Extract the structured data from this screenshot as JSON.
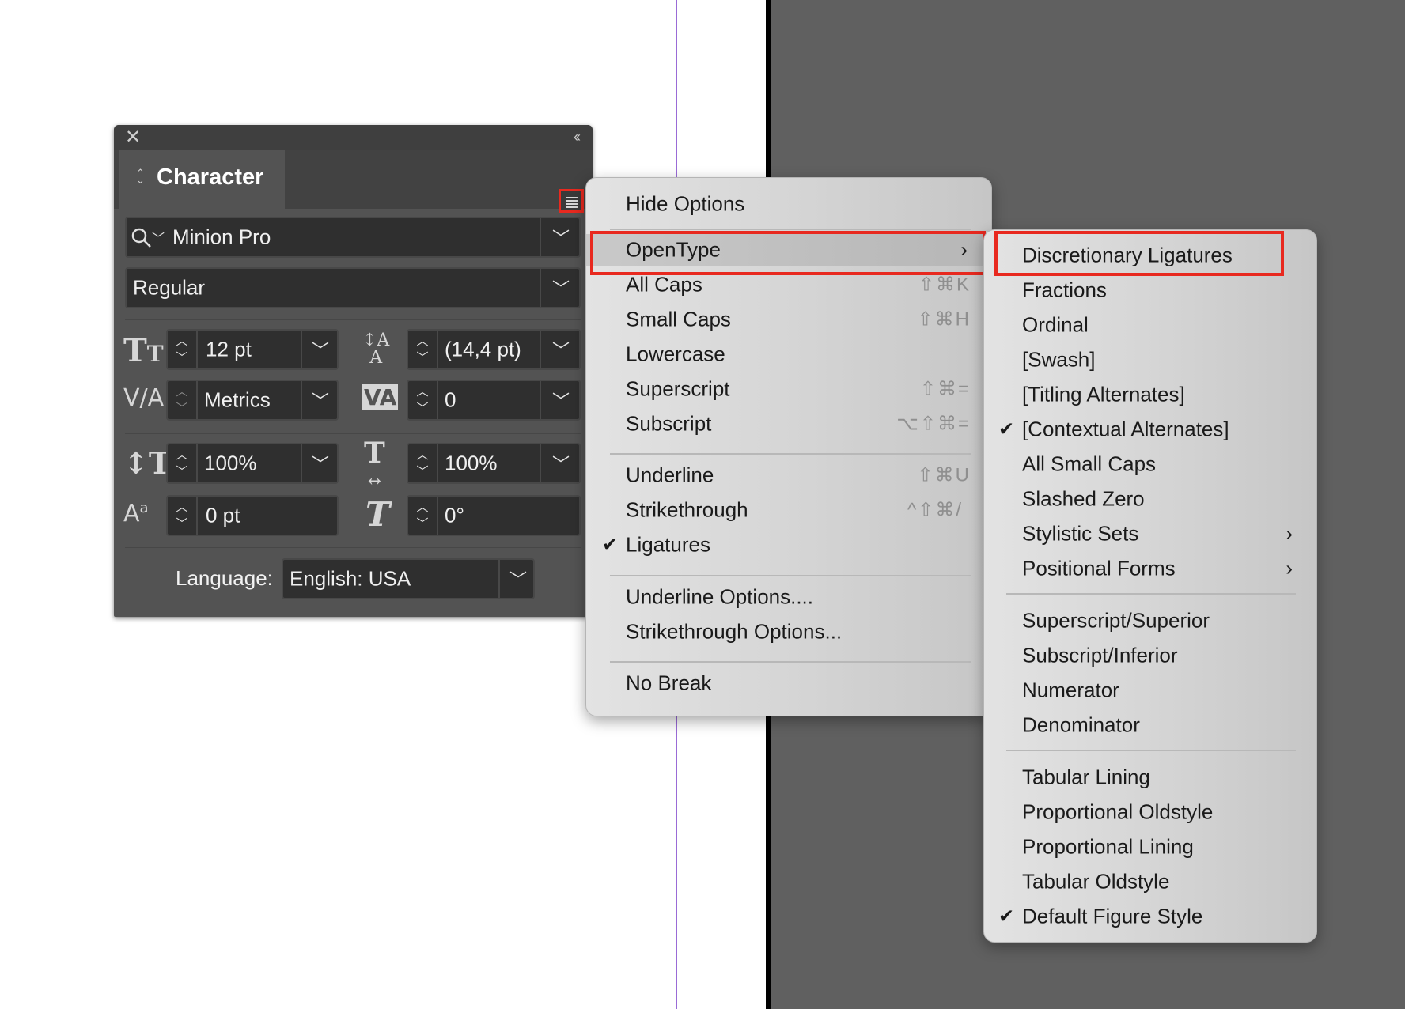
{
  "panel": {
    "title": "Character",
    "font_family": "Minion Pro",
    "font_style": "Regular",
    "font_size": "12 pt",
    "leading": "(14,4 pt)",
    "kerning": "Metrics",
    "tracking": "0",
    "vertical_scale": "100%",
    "horizontal_scale": "100%",
    "baseline_shift": "0 pt",
    "skew": "0°",
    "language_label": "Language:",
    "language_value": "English: USA"
  },
  "menu": {
    "items": [
      {
        "label": "Hide Options"
      },
      {
        "label": "OpenType"
      },
      {
        "label": "All Caps",
        "shortcut": "⇧⌘K"
      },
      {
        "label": "Small Caps",
        "shortcut": "⇧⌘H"
      },
      {
        "label": "Lowercase"
      },
      {
        "label": "Superscript",
        "shortcut": "⇧⌘="
      },
      {
        "label": "Subscript",
        "shortcut": "⌥⇧⌘="
      },
      {
        "label": "Underline",
        "shortcut": "⇧⌘U"
      },
      {
        "label": "Strikethrough",
        "shortcut": "^⇧⌘/"
      },
      {
        "label": "Ligatures",
        "checked": true
      },
      {
        "label": "Underline Options...."
      },
      {
        "label": "Strikethrough Options..."
      },
      {
        "label": "No Break"
      }
    ]
  },
  "submenu": {
    "items": [
      {
        "label": "Discretionary Ligatures"
      },
      {
        "label": "Fractions"
      },
      {
        "label": "Ordinal"
      },
      {
        "label": "[Swash]"
      },
      {
        "label": "[Titling Alternates]"
      },
      {
        "label": "[Contextual Alternates]",
        "checked": true
      },
      {
        "label": "All Small Caps"
      },
      {
        "label": "Slashed Zero"
      },
      {
        "label": "Stylistic Sets"
      },
      {
        "label": "Positional Forms"
      },
      {
        "label": "Superscript/Superior"
      },
      {
        "label": "Subscript/Inferior"
      },
      {
        "label": "Numerator"
      },
      {
        "label": "Denominator"
      },
      {
        "label": "Tabular Lining"
      },
      {
        "label": "Proportional Oldstyle"
      },
      {
        "label": "Proportional Lining"
      },
      {
        "label": "Tabular Oldstyle"
      },
      {
        "label": "Default Figure Style",
        "checked": true
      }
    ]
  },
  "colors": {
    "highlight_box": "#e8291f",
    "panel_bg": "#535353",
    "pasteboard": "#606060",
    "guide": "#9a6bd6"
  }
}
